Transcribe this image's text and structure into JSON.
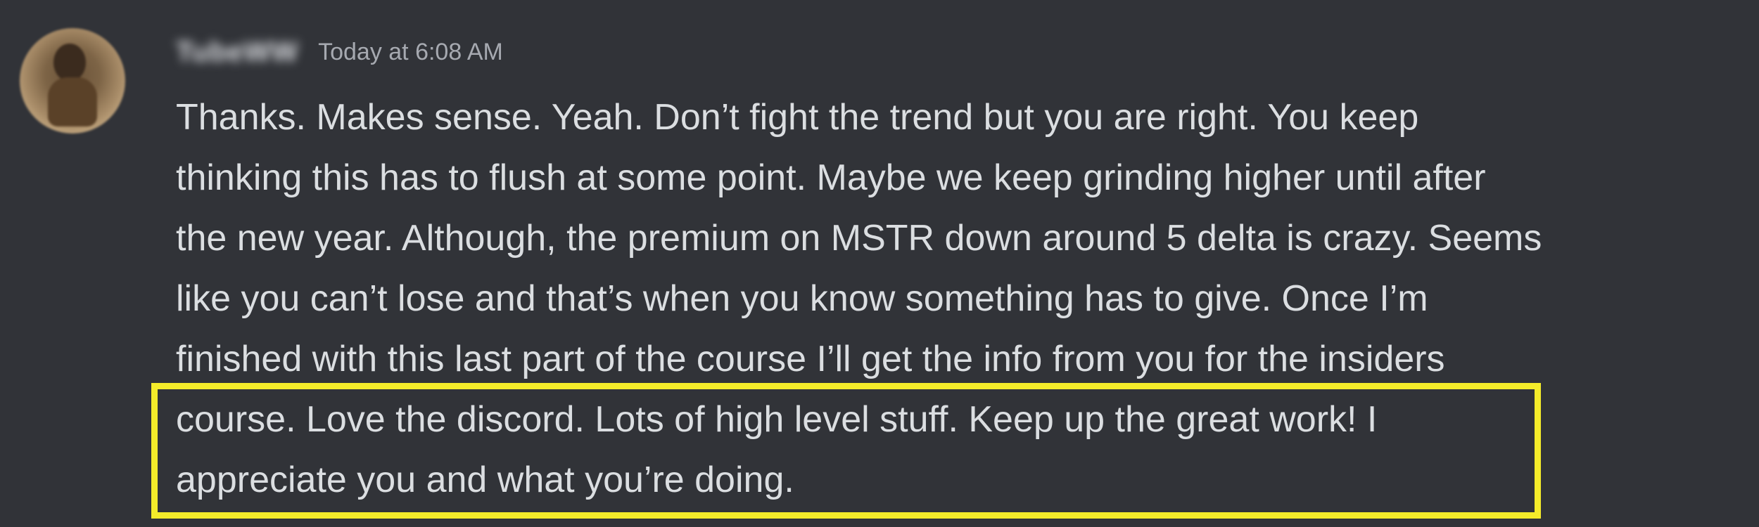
{
  "message": {
    "username": "TubeWW",
    "timestamp": "Today at 6:08 AM",
    "lines": [
      "Thanks. Makes sense. Yeah. Don’t fight the trend but you are right. You keep",
      "thinking this has to flush at some point. Maybe we keep grinding higher until after",
      "the new year. Although, the premium on MSTR down around 5 delta is crazy. Seems",
      "like you can’t lose and that’s when you know something has to give. Once I’m",
      "finished with this last part of the course I’ll get the info from you for the insiders",
      "course. Love the discord. Lots of high level stuff. Keep up the great work! I",
      "appreciate you and what you’re doing."
    ]
  },
  "highlight": {
    "color": "#f4ec2a"
  }
}
